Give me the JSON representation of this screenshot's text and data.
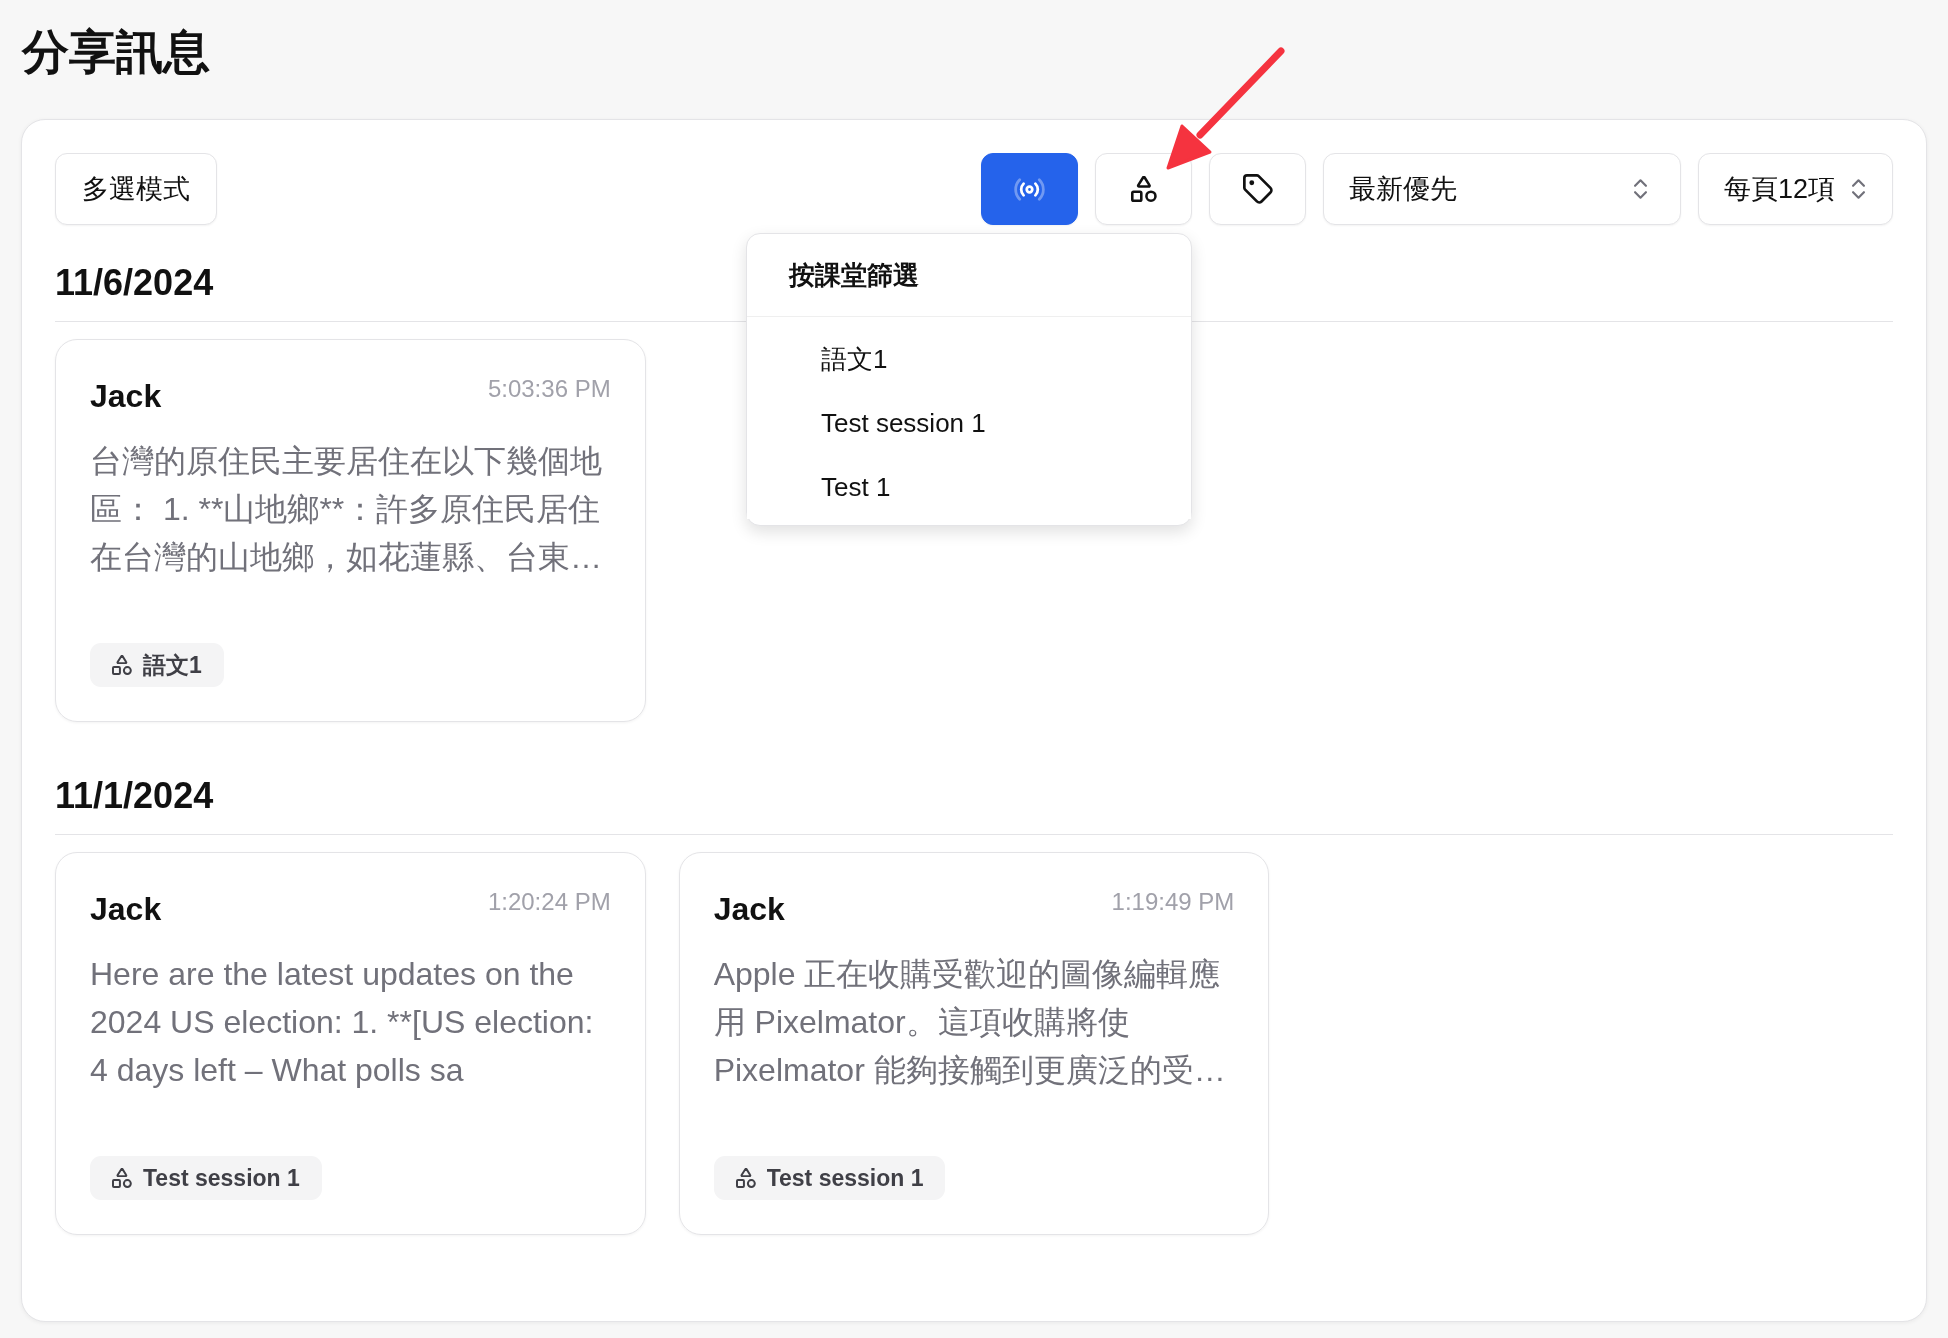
{
  "page_title": "分享訊息",
  "toolbar": {
    "multi_select_button": {
      "label": "多選模式"
    },
    "live_toggle": {
      "on": true
    },
    "session_filter": {
      "expanded": true,
      "menu": {
        "title": "按課堂篩選",
        "items": [
          {
            "label": "語文1",
            "selected": false
          },
          {
            "label": "Test session 1",
            "selected": false
          },
          {
            "label": "Test 1",
            "selected": false
          }
        ]
      }
    },
    "sort_select": {
      "value": "最新優先"
    },
    "page_size_select": {
      "value": "每頁12項"
    }
  },
  "groups": [
    {
      "date": "11/6/2024",
      "messages": [
        {
          "author": "Jack",
          "time": "5:03:36 PM",
          "text": "台灣的原住民主要居住在以下幾個地區： 1. **山地鄉**：許多原住民居住在台灣的山地鄉，如花蓮縣、台東…",
          "session": "語文1"
        }
      ]
    },
    {
      "date": "11/1/2024",
      "messages": [
        {
          "author": "Jack",
          "time": "1:20:24 PM",
          "text": "Here are the latest updates on the 2024 US election: 1. **[US election: 4 days left – What polls sa",
          "session": "Test session 1"
        },
        {
          "author": "Jack",
          "time": "1:19:49 PM",
          "text": "Apple 正在收購受歡迎的圖像編輯應用 Pixelmator。這項收購將使 Pixelmator 能夠接觸到更廣泛的受…",
          "session": "Test session 1"
        }
      ]
    }
  ]
}
